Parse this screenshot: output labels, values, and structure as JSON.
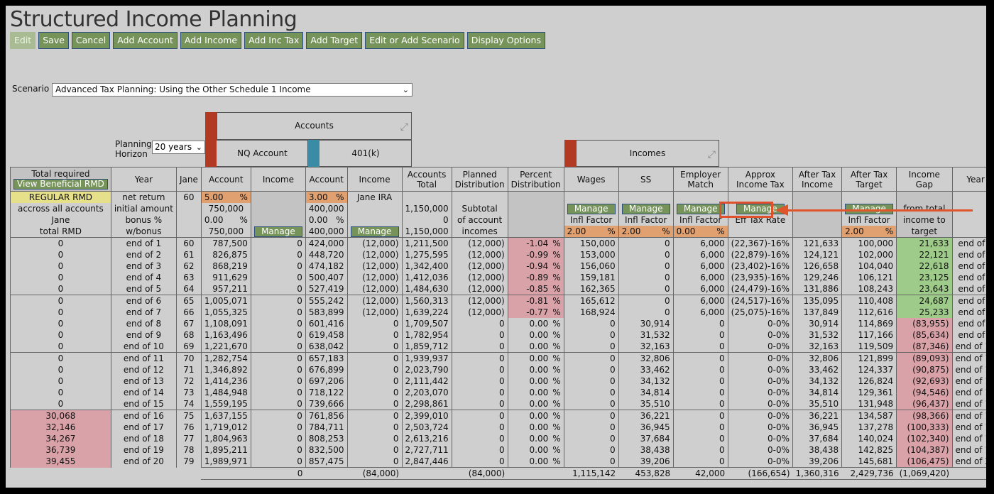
{
  "app_title": "Structured Income Planning",
  "toolbar": [
    "Edit",
    "Save",
    "Cancel",
    "Add Account",
    "Add Income",
    "Add Inc Tax",
    "Add Target",
    "Edit or Add Scenario",
    "Display Options"
  ],
  "scenario": {
    "label": "Scenario",
    "value": "Advanced Tax Planning: Using the Other Schedule 1 Income"
  },
  "planning": {
    "label_1": "Planning",
    "label_2": "Horizon",
    "value": "20 years"
  },
  "groups": {
    "accounts": "Accounts",
    "incomes": "Incomes",
    "nq": "NQ Account",
    "k401": "401(k)"
  },
  "headers": {
    "total_required": "Total required",
    "view_rmd": "View Beneficial RMD",
    "year": "Year",
    "jane": "Jane",
    "account": "Account",
    "income": "Income",
    "accounts_total_1": "Accounts",
    "accounts_total_2": "Total",
    "planned_1": "Planned",
    "planned_2": "Distribution",
    "percent_1": "Percent",
    "percent_2": "Distribution",
    "wages": "Wages",
    "ss": "SS",
    "emp_1": "Employer",
    "emp_2": "Match",
    "tax_1": "Approx",
    "tax_2": "Income Tax",
    "after_tax_1": "After Tax",
    "after_tax_2": "Income",
    "target_1": "After Tax",
    "target_2": "Target",
    "gap_1": "Income",
    "gap_2": "Gap",
    "year2": "Year"
  },
  "setup": {
    "regular_rmd": "REGULAR RMD",
    "across": "accross all accounts",
    "jane": "Jane",
    "total_rmd": "total RMD",
    "jane_age": "60",
    "net_return": "net return",
    "initial_amount": "initial amount",
    "bonus": "bonus %",
    "w_bonus": "w/bonus",
    "nq_rate": "5.00",
    "nq_initial": "750,000",
    "nq_bonus": "0.00",
    "nq_wbonus": "750,000",
    "k_rate": "3.00",
    "k_initial": "400,000",
    "k_bonus": "0.00",
    "k_wbonus": "400,000",
    "jane_ira": "Jane IRA",
    "manage": "Manage",
    "pct": "%",
    "total_initial": "1,150,000",
    "total_bonus": "0",
    "total_wbonus": "1,150,000",
    "subtotal_1": "Subtotal",
    "subtotal_2": "of account",
    "subtotal_3": "incomes",
    "infl": "Infl Factor",
    "wages_infl": "2.00",
    "ss_infl": "2.00",
    "emp_infl": "0.00",
    "eff_tax": "Eff Tax Rate",
    "target_infl": "2.00",
    "gap_1": "from total",
    "gap_2": "income to",
    "gap_3": "target"
  },
  "rows": [
    {
      "rmd": "0",
      "year": "end of 1",
      "age": "60",
      "nq": "787,500",
      "nq_inc": "0",
      "k": "424,000",
      "k_inc": "(12,000)",
      "tot": "1,211,500",
      "plan": "(12,000)",
      "pct": "-1.04",
      "wages": "150,000",
      "ss": "0",
      "emp": "6,000",
      "tax": "(22,367)-16%",
      "ati": "121,633",
      "tgt": "100,000",
      "gap": "21,633"
    },
    {
      "rmd": "0",
      "year": "end of 2",
      "age": "61",
      "nq": "826,875",
      "nq_inc": "0",
      "k": "448,720",
      "k_inc": "(12,000)",
      "tot": "1,275,595",
      "plan": "(12,000)",
      "pct": "-0.99",
      "wages": "153,000",
      "ss": "0",
      "emp": "6,000",
      "tax": "(22,879)-16%",
      "ati": "124,121",
      "tgt": "102,000",
      "gap": "22,121"
    },
    {
      "rmd": "0",
      "year": "end of 3",
      "age": "62",
      "nq": "868,219",
      "nq_inc": "0",
      "k": "474,182",
      "k_inc": "(12,000)",
      "tot": "1,342,400",
      "plan": "(12,000)",
      "pct": "-0.94",
      "wages": "156,060",
      "ss": "0",
      "emp": "6,000",
      "tax": "(23,402)-16%",
      "ati": "126,658",
      "tgt": "104,040",
      "gap": "22,618"
    },
    {
      "rmd": "0",
      "year": "end of 4",
      "age": "63",
      "nq": "911,629",
      "nq_inc": "0",
      "k": "500,407",
      "k_inc": "(12,000)",
      "tot": "1,412,036",
      "plan": "(12,000)",
      "pct": "-0.89",
      "wages": "159,181",
      "ss": "0",
      "emp": "6,000",
      "tax": "(23,935)-16%",
      "ati": "129,246",
      "tgt": "106,121",
      "gap": "23,125"
    },
    {
      "rmd": "0",
      "year": "end of 5",
      "age": "64",
      "nq": "957,211",
      "nq_inc": "0",
      "k": "527,419",
      "k_inc": "(12,000)",
      "tot": "1,484,630",
      "plan": "(12,000)",
      "pct": "-0.85",
      "wages": "162,365",
      "ss": "0",
      "emp": "6,000",
      "tax": "(24,479)-16%",
      "ati": "131,886",
      "tgt": "108,243",
      "gap": "23,643"
    },
    {
      "rmd": "0",
      "year": "end of 6",
      "age": "65",
      "nq": "1,005,071",
      "nq_inc": "0",
      "k": "555,242",
      "k_inc": "(12,000)",
      "tot": "1,560,313",
      "plan": "(12,000)",
      "pct": "-0.81",
      "wages": "165,612",
      "ss": "0",
      "emp": "6,000",
      "tax": "(24,517)-16%",
      "ati": "135,095",
      "tgt": "110,408",
      "gap": "24,687"
    },
    {
      "rmd": "0",
      "year": "end of 7",
      "age": "66",
      "nq": "1,055,325",
      "nq_inc": "0",
      "k": "583,899",
      "k_inc": "(12,000)",
      "tot": "1,639,224",
      "plan": "(12,000)",
      "pct": "-0.77",
      "wages": "168,924",
      "ss": "0",
      "emp": "6,000",
      "tax": "(25,075)-16%",
      "ati": "137,849",
      "tgt": "112,616",
      "gap": "25,233"
    },
    {
      "rmd": "0",
      "year": "end of 8",
      "age": "67",
      "nq": "1,108,091",
      "nq_inc": "0",
      "k": "601,416",
      "k_inc": "0",
      "tot": "1,709,507",
      "plan": "0",
      "pct": "0.00",
      "wages": "0",
      "ss": "30,914",
      "emp": "0",
      "tax": "0-0%",
      "ati": "30,914",
      "tgt": "114,869",
      "gap": "(83,955)"
    },
    {
      "rmd": "0",
      "year": "end of 9",
      "age": "68",
      "nq": "1,163,496",
      "nq_inc": "0",
      "k": "619,458",
      "k_inc": "0",
      "tot": "1,782,954",
      "plan": "0",
      "pct": "0.00",
      "wages": "0",
      "ss": "31,532",
      "emp": "0",
      "tax": "0-0%",
      "ati": "31,532",
      "tgt": "117,166",
      "gap": "(85,634)"
    },
    {
      "rmd": "0",
      "year": "end of 10",
      "age": "69",
      "nq": "1,221,670",
      "nq_inc": "0",
      "k": "638,042",
      "k_inc": "0",
      "tot": "1,859,712",
      "plan": "0",
      "pct": "0.00",
      "wages": "0",
      "ss": "32,163",
      "emp": "0",
      "tax": "0-0%",
      "ati": "32,163",
      "tgt": "119,509",
      "gap": "(87,346)"
    },
    {
      "rmd": "0",
      "year": "end of 11",
      "age": "70",
      "nq": "1,282,754",
      "nq_inc": "0",
      "k": "657,183",
      "k_inc": "0",
      "tot": "1,939,937",
      "plan": "0",
      "pct": "0.00",
      "wages": "0",
      "ss": "32,806",
      "emp": "0",
      "tax": "0-0%",
      "ati": "32,806",
      "tgt": "121,899",
      "gap": "(89,093)"
    },
    {
      "rmd": "0",
      "year": "end of 12",
      "age": "71",
      "nq": "1,346,892",
      "nq_inc": "0",
      "k": "676,899",
      "k_inc": "0",
      "tot": "2,023,790",
      "plan": "0",
      "pct": "0.00",
      "wages": "0",
      "ss": "33,462",
      "emp": "0",
      "tax": "0-0%",
      "ati": "33,462",
      "tgt": "124,337",
      "gap": "(90,875)"
    },
    {
      "rmd": "0",
      "year": "end of 13",
      "age": "72",
      "nq": "1,414,236",
      "nq_inc": "0",
      "k": "697,206",
      "k_inc": "0",
      "tot": "2,111,442",
      "plan": "0",
      "pct": "0.00",
      "wages": "0",
      "ss": "34,132",
      "emp": "0",
      "tax": "0-0%",
      "ati": "34,132",
      "tgt": "126,824",
      "gap": "(92,693)"
    },
    {
      "rmd": "0",
      "year": "end of 14",
      "age": "73",
      "nq": "1,484,948",
      "nq_inc": "0",
      "k": "718,122",
      "k_inc": "0",
      "tot": "2,203,070",
      "plan": "0",
      "pct": "0.00",
      "wages": "0",
      "ss": "34,814",
      "emp": "0",
      "tax": "0-0%",
      "ati": "34,814",
      "tgt": "129,361",
      "gap": "(94,546)"
    },
    {
      "rmd": "0",
      "year": "end of 15",
      "age": "74",
      "nq": "1,559,195",
      "nq_inc": "0",
      "k": "739,666",
      "k_inc": "0",
      "tot": "2,298,861",
      "plan": "0",
      "pct": "0.00",
      "wages": "0",
      "ss": "35,510",
      "emp": "0",
      "tax": "0-0%",
      "ati": "35,510",
      "tgt": "131,948",
      "gap": "(96,437)"
    },
    {
      "rmd": "30,068",
      "year": "end of 16",
      "age": "75",
      "nq": "1,637,155",
      "nq_inc": "0",
      "k": "761,856",
      "k_inc": "0",
      "tot": "2,399,010",
      "plan": "0",
      "pct": "0.00",
      "wages": "0",
      "ss": "36,221",
      "emp": "0",
      "tax": "0-0%",
      "ati": "36,221",
      "tgt": "134,587",
      "gap": "(98,366)"
    },
    {
      "rmd": "32,146",
      "year": "end of 17",
      "age": "76",
      "nq": "1,719,012",
      "nq_inc": "0",
      "k": "784,711",
      "k_inc": "0",
      "tot": "2,503,724",
      "plan": "0",
      "pct": "0.00",
      "wages": "0",
      "ss": "36,945",
      "emp": "0",
      "tax": "0-0%",
      "ati": "36,945",
      "tgt": "137,278",
      "gap": "(100,333)"
    },
    {
      "rmd": "34,267",
      "year": "end of 18",
      "age": "77",
      "nq": "1,804,963",
      "nq_inc": "0",
      "k": "808,253",
      "k_inc": "0",
      "tot": "2,613,216",
      "plan": "0",
      "pct": "0.00",
      "wages": "0",
      "ss": "37,684",
      "emp": "0",
      "tax": "0-0%",
      "ati": "37,684",
      "tgt": "140,024",
      "gap": "(102,340)"
    },
    {
      "rmd": "36,739",
      "year": "end of 19",
      "age": "78",
      "nq": "1,895,211",
      "nq_inc": "0",
      "k": "832,500",
      "k_inc": "0",
      "tot": "2,727,711",
      "plan": "0",
      "pct": "0.00",
      "wages": "0",
      "ss": "38,438",
      "emp": "0",
      "tax": "0-0%",
      "ati": "38,438",
      "tgt": "142,825",
      "gap": "(104,387)"
    },
    {
      "rmd": "39,455",
      "year": "end of 20",
      "age": "79",
      "nq": "1,989,971",
      "nq_inc": "0",
      "k": "857,475",
      "k_inc": "0",
      "tot": "2,847,446",
      "plan": "0",
      "pct": "0.00",
      "wages": "0",
      "ss": "39,206",
      "emp": "0",
      "tax": "0-0%",
      "ati": "39,206",
      "tgt": "145,681",
      "gap": "(106,475)"
    }
  ],
  "totals": {
    "nq_inc": "0",
    "k_inc": "(84,000)",
    "plan": "(84,000)",
    "wages": "1,115,142",
    "ss": "453,828",
    "emp": "42,000",
    "tax": "(166,654)",
    "ati": "1,360,316",
    "tgt": "2,429,736",
    "gap": "(1,069,420)"
  },
  "colors": {
    "button_green": "#76935a",
    "orange": "#e0a070",
    "pink": "#d9a2a8",
    "green": "#9fcb8a",
    "yellow": "#e6e08a",
    "accent_red": "#b23a22",
    "accent_blue": "#3a8ca6",
    "callout": "#e0562a"
  }
}
